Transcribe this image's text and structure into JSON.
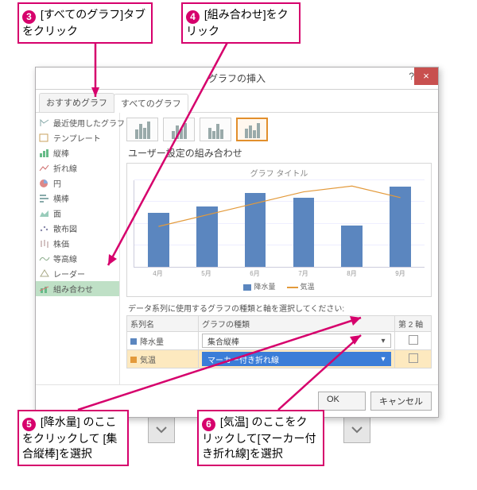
{
  "callouts": {
    "c3": {
      "num": "3",
      "text": " [すべてのグラフ]タブをクリック"
    },
    "c4": {
      "num": "4",
      "text": " [組み合わせ]をクリック"
    },
    "c5": {
      "num": "5",
      "text": "  [降水量] のここをクリックして [集合縦棒]を選択"
    },
    "c6": {
      "num": "6",
      "text": "  [気温] のここをクリックして[マーカー付き折れ線]を選択"
    }
  },
  "dialog": {
    "title": "グラフの挿入",
    "help": "?",
    "close": "×",
    "tabs": {
      "recommended": "おすすめグラフ",
      "all": "すべてのグラフ"
    },
    "sidebar": [
      "最近使用したグラフ",
      "テンプレート",
      "縦棒",
      "折れ線",
      "円",
      "横棒",
      "面",
      "散布図",
      "株価",
      "等高線",
      "レーダー",
      "組み合わせ"
    ],
    "subhead": "ユーザー設定の組み合わせ",
    "chart_title": "グラフ タイトル",
    "legend": {
      "s1": "降水量",
      "s2": "気温"
    },
    "instr": "データ系列に使用するグラフの種類と軸を選択してください:",
    "table": {
      "h_series": "系列名",
      "h_type": "グラフの種類",
      "h_axis2": "第 2 軸",
      "r1_name": "降水量",
      "r1_type": "集合縦棒",
      "r2_name": "気温",
      "r2_type": "マーカー付き折れ線"
    },
    "ok": "OK",
    "cancel": "キャンセル"
  },
  "chart_data": {
    "type": "bar",
    "title": "グラフ タイトル",
    "categories": [
      "4月",
      "5月",
      "6月",
      "7月",
      "8月",
      "9月"
    ],
    "series": [
      {
        "name": "降水量",
        "type": "bar",
        "values": [
          125,
          140,
          170,
          160,
          95,
          185
        ]
      },
      {
        "name": "気温",
        "type": "line",
        "values": [
          14,
          18,
          22,
          26,
          28,
          24
        ]
      }
    ],
    "ylim": [
      0,
      200
    ],
    "y2lim": [
      0,
      30
    ]
  }
}
